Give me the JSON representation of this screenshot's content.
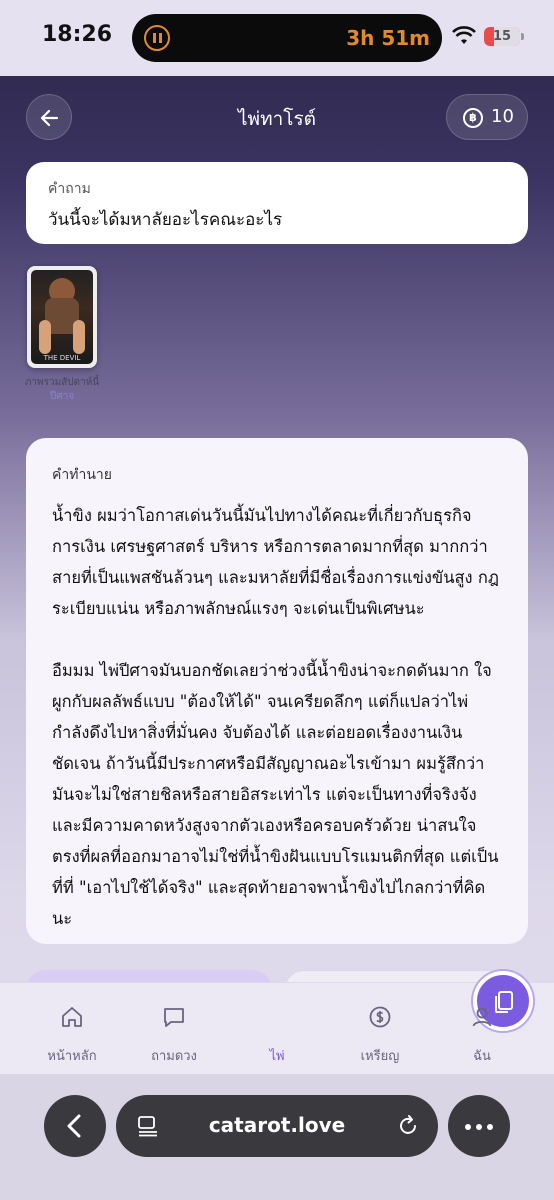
{
  "status_bar": {
    "time": "18:26",
    "timer": "3h 51m",
    "battery": "15"
  },
  "header": {
    "title": "ไพ่ทาโรต์",
    "coins": "10"
  },
  "question": {
    "label": "คำถาม",
    "text": "วันนี้จะได้มหาลัยอะไรคณะอะไร"
  },
  "card": {
    "art_caption": "THE DEVIL",
    "name": "ภาพรวมสัปดาห์นี้",
    "sub": "ปีศาจ"
  },
  "prediction": {
    "label": "คำทำนาย",
    "paragraphs": [
      "น้ำขิง ผมว่าโอกาสเด่นวันนี้มันไปทางได้คณะที่เกี่ยวกับธุรกิจ การเงิน เศรษฐศาสตร์ บริหาร หรือการตลาดมากที่สุด มากกว่าสายที่เป็นแพสชันล้วนๆ และมหาลัยที่มีชื่อเรื่องการแข่งขันสูง กฎระเบียบแน่น หรือภาพลักษณ์แรงๆ จะเด่นเป็นพิเศษนะ",
      "อืมมม ไพ่ปีศาจมันบอกชัดเลยว่าช่วงนี้น้ำขิงน่าจะกดดันมาก ใจผูกกับผลลัพธ์แบบ \"ต้องให้ได้\" จนเครียดลึกๆ แต่ก็แปลว่าไพ่กำลังดึงไปหาสิ่งที่มั่นคง จับต้องได้ และต่อยอดเรื่องงานเงินชัดเจน ถ้าวันนี้มีประกาศหรือมีสัญญาณอะไรเข้ามา ผมรู้สึกว่ามันจะไม่ใช่สายชิลหรือสายอิสระเท่าไร แต่จะเป็นทางที่จริงจังและมีความคาดหวังสูงจากตัวเองหรือครอบครัวด้วย น่าสนใจตรงที่ผลที่ออกมาอาจไม่ใช่ที่น้ำขิงฝันแบบโรแมนติกที่สุด แต่เป็นที่ที่ \"เอาไปใช้ได้จริง\" และสุดท้ายอาจพาน้ำขิงไปไกลกว่าที่คิดนะ"
    ]
  },
  "nav": {
    "items": [
      {
        "label": "หน้าหลัก",
        "icon": "home-icon"
      },
      {
        "label": "ถามดวง",
        "icon": "chat-icon"
      },
      {
        "label": "ไพ่",
        "icon": "cards-icon"
      },
      {
        "label": "เหรียญ",
        "icon": "coin-icon"
      },
      {
        "label": "ฉัน",
        "icon": "user-icon"
      }
    ],
    "active_color": "#7b5ce0"
  },
  "browser": {
    "url": "catarot.love"
  }
}
